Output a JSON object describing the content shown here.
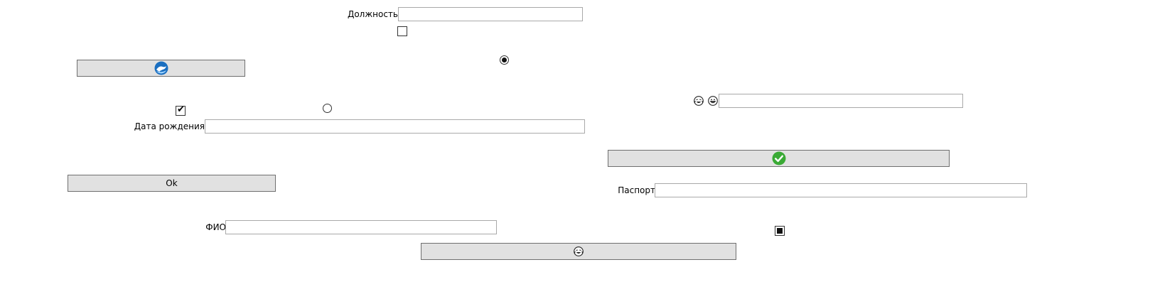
{
  "form": {
    "position_label": "Должность",
    "position_value": "",
    "birthdate_label": "Дата рождения",
    "birthdate_value": "",
    "fio_label": "ФИО",
    "fio_value": "",
    "passport_label": "Паспорт",
    "passport_value": "",
    "emoji_field_value": ""
  },
  "buttons": {
    "ok_label": "Ok",
    "dolphin_icon": "dolphin-logo-icon",
    "check_icon": "green-check-icon",
    "emoji_icon": "smiley-emoji-icon"
  },
  "controls": {
    "checkbox_top_checked": false,
    "checkbox_left_checked": true,
    "checkbox_indeterminate": true,
    "radio_top_selected": true,
    "radio_mid_selected": false
  },
  "colors": {
    "button_bg": "#e1e1e1",
    "button_border": "#6f6f6f",
    "field_border": "#a9a9a9",
    "check_green": "#3aaa35",
    "dolphin_blue": "#1b6fc0"
  }
}
